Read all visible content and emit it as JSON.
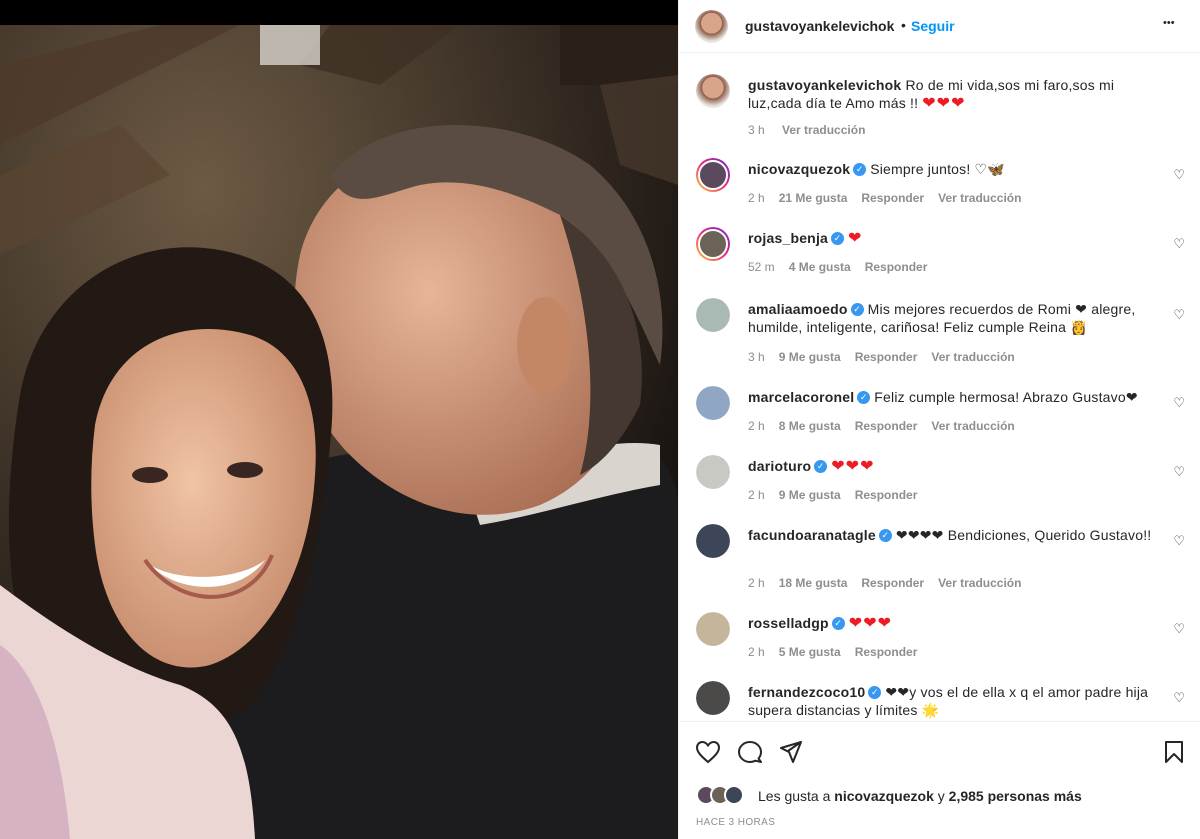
{
  "header": {
    "username": "gustavoyankelevichok",
    "dot": "•",
    "follow_label": "Seguir",
    "more_label": "•••"
  },
  "caption": {
    "username": "gustavoyankelevichok",
    "text": "Ro de mi vida,sos mi faro,sos mi luz,cada día te Amo más !!",
    "emoji": "❤❤❤",
    "time": "3 h",
    "translate": "Ver traducción"
  },
  "comments": [
    {
      "username": "nicovazquezok",
      "verified": true,
      "text": "Siempre juntos! ♡🦋",
      "time": "2 h",
      "likes": "21 Me gusta",
      "reply": "Responder",
      "translate": "Ver traducción",
      "avatar_color": "#5b4a5e",
      "ring": true
    },
    {
      "username": "rojas_benja",
      "verified": true,
      "text": "❤",
      "time": "52 m",
      "likes": "4 Me gusta",
      "reply": "Responder",
      "translate": "",
      "avatar_color": "#6b6258",
      "ring": true
    },
    {
      "username": "amaliaamoedo",
      "verified": true,
      "text": "Mis mejores recuerdos de Romi ❤ alegre, humilde, inteligente, cariñosa! Feliz cumple Reina 👸",
      "time": "3 h",
      "likes": "9 Me gusta",
      "reply": "Responder",
      "translate": "Ver traducción",
      "avatar_color": "#a9b9b3",
      "ring": false
    },
    {
      "username": "marcelacoronel",
      "verified": true,
      "text": "Feliz cumple hermosa! Abrazo Gustavo❤",
      "time": "2 h",
      "likes": "8 Me gusta",
      "reply": "Responder",
      "translate": "Ver traducción",
      "avatar_color": "#8fa7c4",
      "ring": false
    },
    {
      "username": "darioturo",
      "verified": true,
      "text": "❤❤❤",
      "time": "2 h",
      "likes": "9 Me gusta",
      "reply": "Responder",
      "translate": "",
      "avatar_color": "#c9c9c4",
      "ring": false
    },
    {
      "username": "facundoaranatagle",
      "verified": true,
      "text": "❤❤❤❤ Bendiciones, Querido Gustavo!!",
      "time": "2 h",
      "likes": "18 Me gusta",
      "reply": "Responder",
      "translate": "Ver traducción",
      "avatar_color": "#3d4659",
      "ring": false
    },
    {
      "username": "rosselladgp",
      "verified": true,
      "text": "❤❤❤",
      "time": "2 h",
      "likes": "5 Me gusta",
      "reply": "Responder",
      "translate": "",
      "avatar_color": "#c5b59a",
      "ring": false
    },
    {
      "username": "fernandezcoco10",
      "verified": true,
      "text": "❤❤y vos el de ella x q el amor padre hija supera distancias y límites 🌟",
      "time": "",
      "likes": "",
      "reply": "",
      "translate": "",
      "avatar_color": "#4b4a48",
      "ring": false
    }
  ],
  "likes": {
    "prefix": "Les gusta a",
    "user": "nicovazquezok",
    "joiner": "y",
    "others": "2,985 personas más"
  },
  "posted": "HACE 3 HORAS",
  "colors": {
    "accent": "#0095f6",
    "heart": "#ed1c24",
    "muted": "#8e8e8e"
  }
}
